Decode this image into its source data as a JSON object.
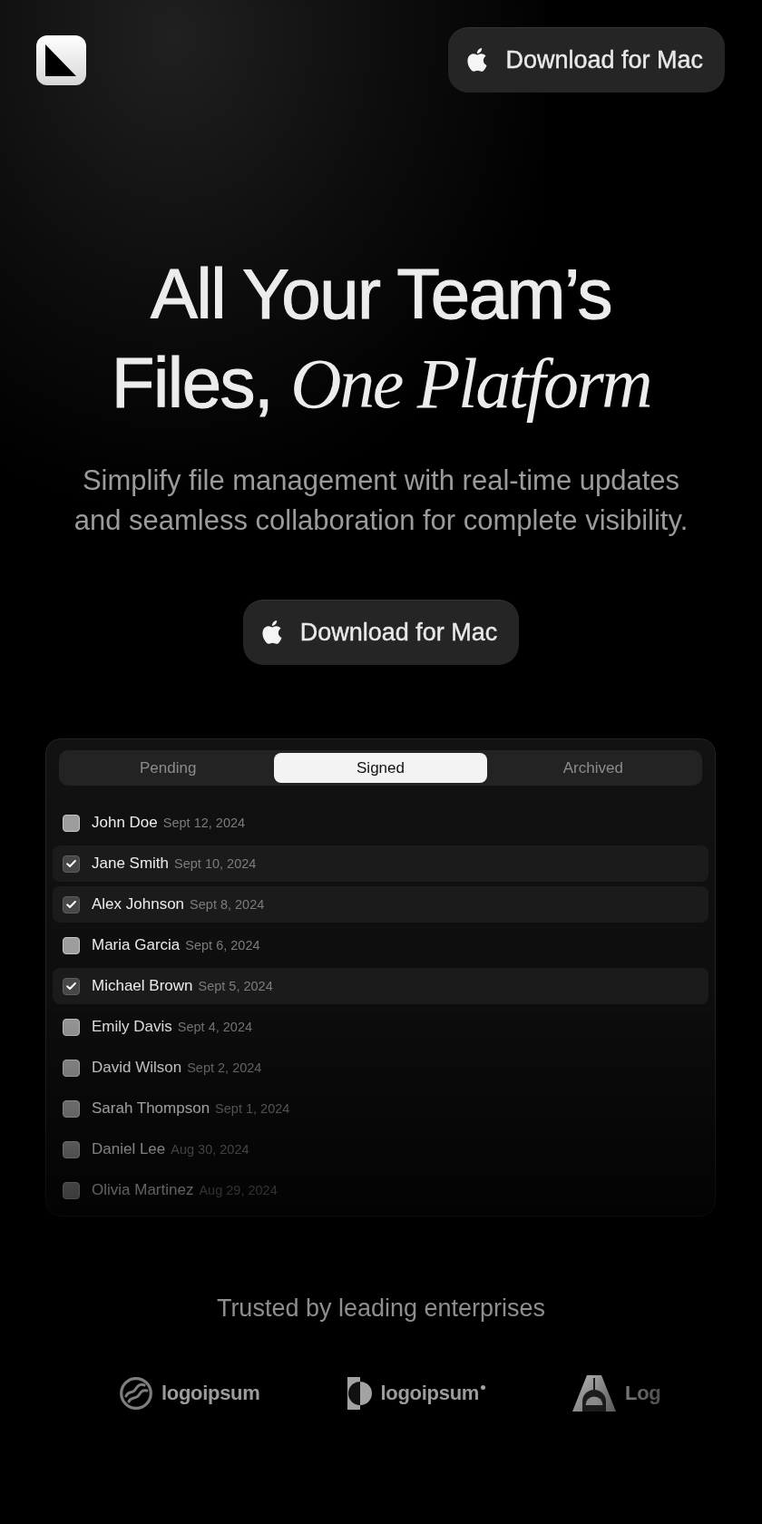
{
  "header": {
    "download_button": {
      "label": "Download for Mac"
    }
  },
  "hero": {
    "headline": "All Your Team’s Files, *One Platform*",
    "subtitle": "Simplify file management with real-time updates and seamless collaboration for complete visibility.",
    "download_button": {
      "label": "Download for Mac"
    }
  },
  "documents": {
    "tabs": [
      {
        "label": "Pending",
        "selected": false
      },
      {
        "label": "Signed",
        "selected": true
      },
      {
        "label": "Archived",
        "selected": false
      }
    ],
    "rows": [
      {
        "name": "John Doe",
        "date": "Sept 12, 2024",
        "checked": false
      },
      {
        "name": "Jane Smith",
        "date": "Sept 10, 2024",
        "checked": true
      },
      {
        "name": "Alex Johnson",
        "date": "Sept 8, 2024",
        "checked": true
      },
      {
        "name": "Maria Garcia",
        "date": "Sept 6, 2024",
        "checked": false
      },
      {
        "name": "Michael Brown",
        "date": "Sept 5, 2024",
        "checked": true
      },
      {
        "name": "Emily Davis",
        "date": "Sept 4, 2024",
        "checked": false
      },
      {
        "name": "David Wilson",
        "date": "Sept 2, 2024",
        "checked": false
      },
      {
        "name": "Sarah Thompson",
        "date": "Sept 1, 2024",
        "checked": false
      },
      {
        "name": "Daniel Lee",
        "date": "Aug 30, 2024",
        "checked": false
      },
      {
        "name": "Olivia Martinez",
        "date": "Aug 29, 2024",
        "checked": false
      }
    ]
  },
  "trusted": {
    "heading": "Trusted by leading enterprises",
    "logos": [
      {
        "kind": "wave-circle",
        "wordmark": "logoipsum",
        "dot": false
      },
      {
        "kind": "split-circle",
        "wordmark": "logoipsum",
        "dot": true
      },
      {
        "kind": "arch",
        "wordmark": "Log",
        "dot": false
      }
    ]
  }
}
